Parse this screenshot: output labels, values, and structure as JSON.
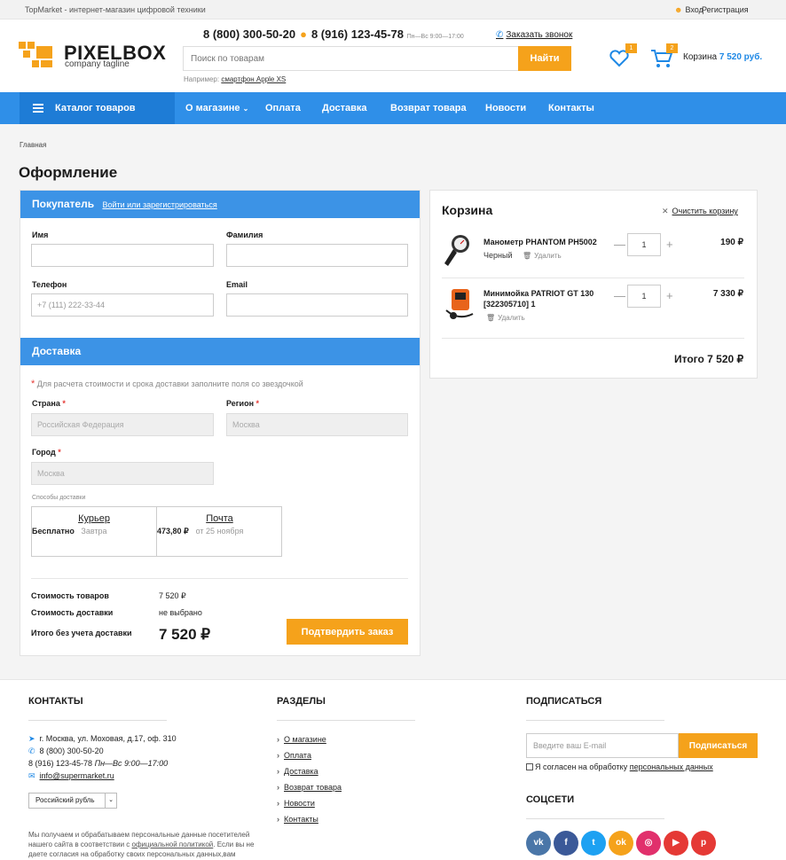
{
  "topbar": {
    "tagline": "TopMarket - интернет-магазин цифровой техники",
    "login": "Вход",
    "register": "Регистрация"
  },
  "header": {
    "logo_name": "PIXELBOX",
    "logo_tagline": "company tagline",
    "phone1": "8 (800) 300-50-20",
    "phone2": "8 (916) 123-45-78",
    "hours": "Пн—Вс 9:00—17:00",
    "callback": "Заказать звонок",
    "search_placeholder": "Поиск по товарам",
    "search_button": "Найти",
    "example_prefix": "Например:",
    "example_link": "смартфон Apple XS",
    "wishlist_count": "1",
    "cart_count": "2",
    "cart_label": "Корзина",
    "cart_total": "7 520 руб."
  },
  "nav": {
    "catalog": "Каталог товаров",
    "items": [
      "О магазине",
      "Оплата",
      "Доставка",
      "Возврат товара",
      "Новости",
      "Контакты"
    ]
  },
  "breadcrumb": "Главная",
  "page_title": "Оформление",
  "buyer": {
    "title": "Покупатель",
    "login_link": "Войти или зарегистрироваться",
    "first_name_label": "Имя",
    "last_name_label": "Фамилия",
    "phone_label": "Телефон",
    "phone_placeholder": "+7 (111) 222-33-44",
    "email_label": "Email"
  },
  "delivery": {
    "title": "Доставка",
    "hint": "Для расчета стоимости и срока доставки заполните поля со звездочкой",
    "country_label": "Страна",
    "country_value": "Российская Федерация",
    "region_label": "Регион",
    "region_value": "Москва",
    "city_label": "Город",
    "city_value": "Москва",
    "methods_label": "Способы доставки",
    "methods": [
      {
        "name": "Курьер",
        "price": "Бесплатно",
        "when": "Завтра"
      },
      {
        "name": "Почта",
        "price": "473,80 ₽",
        "when": "от 25 ноября"
      }
    ]
  },
  "summary": {
    "goods_label": "Стоимость товаров",
    "goods_value": "7 520 ₽",
    "delivery_label": "Стоимость доставки",
    "delivery_value": "не выбрано",
    "total_label": "Итого без учета доставки",
    "total_value": "7 520 ₽",
    "confirm": "Подтвердить заказ"
  },
  "cart": {
    "title": "Корзина",
    "clear": "Очистить корзину",
    "delete": "Удалить",
    "items": [
      {
        "name": "Манометр PHANTOM PH5002",
        "color": "Черный",
        "qty": "1",
        "price": "190 ₽"
      },
      {
        "name": "Минимойка PATRIOT GT 130 [322305710] 1",
        "qty": "1",
        "price": "7 330 ₽"
      }
    ],
    "total": "Итого 7 520 ₽"
  },
  "footer": {
    "contacts_title": "КОНТАКТЫ",
    "address": "г. Москва, ул. Моховая, д.17, оф. 310",
    "phone1": "8 (800) 300-50-20",
    "phone2": "8 (916) 123-45-78",
    "hours": "Пн—Вс 9:00—17:00",
    "email": "info@supermarket.ru",
    "currency": "Российский рубль",
    "privacy_1": "Мы получаем и обрабатываем персональные данные посетителей нашего сайта в соответствии с",
    "privacy_link": "официальной политикой",
    "privacy_2": ". Если вы не даете согласия на обработку своих персональных данных,вам",
    "sections_title": "РАЗДЕЛЫ",
    "sections": [
      "О магазине",
      "Оплата",
      "Доставка",
      "Возврат товара",
      "Новости",
      "Контакты"
    ],
    "subscribe_title": "ПОДПИСАТЬСЯ",
    "subscribe_placeholder": "Введите ваш E-mail",
    "subscribe_button": "Подписаться",
    "agree_prefix": "Я согласен на обработку",
    "agree_link": "персональных данных",
    "social_title": "СОЦСЕТИ",
    "social": [
      {
        "icon": "vk-icon",
        "glyph": "vk",
        "color": "#4a76a8"
      },
      {
        "icon": "facebook-icon",
        "glyph": "f",
        "color": "#3b5998"
      },
      {
        "icon": "twitter-icon",
        "glyph": "t",
        "color": "#1da1f2"
      },
      {
        "icon": "odnoklassniki-icon",
        "glyph": "ok",
        "color": "#f5a21b"
      },
      {
        "icon": "instagram-icon",
        "glyph": "◎",
        "color": "#e1306c"
      },
      {
        "icon": "youtube-icon",
        "glyph": "▶",
        "color": "#e53935"
      },
      {
        "icon": "pinterest-icon",
        "glyph": "p",
        "color": "#e53935"
      }
    ]
  }
}
